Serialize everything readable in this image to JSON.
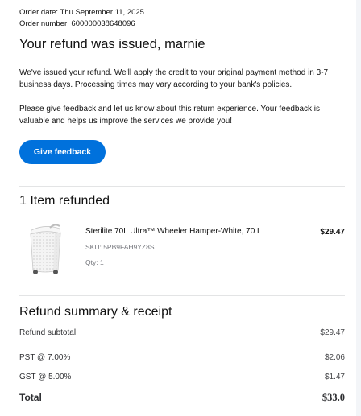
{
  "order": {
    "date_text": "Order date: Thu September 11, 2025",
    "number_text": "Order number: 600000038648096"
  },
  "header": {
    "title": "Your refund was issued, marnie"
  },
  "messages": {
    "refund_info": "We've issued your refund. We'll apply the credit to your original payment method in 3-7 business days. Processing times may vary according to your bank's policies.",
    "feedback_info": "Please give feedback and let us know about this return experience. Your feedback is valuable and helps us improve the services we provide you!"
  },
  "feedback_button": {
    "label": "Give feedback",
    "color": "#0071dc"
  },
  "items_section": {
    "title": "1 Item refunded",
    "items": [
      {
        "name": "Sterilite 70L Ultra™ Wheeler Hamper-White, 70 L",
        "sku": "SKU: 5PB9FAH9YZ8S",
        "qty": "Qty: 1",
        "price": "$29.47",
        "image_icon": "laundry-hamper-image"
      }
    ]
  },
  "summary": {
    "title": "Refund summary & receipt",
    "rows": [
      {
        "label": "Refund subtotal",
        "value": "$29.47"
      },
      {
        "label": "PST @ 7.00%",
        "value": "$2.06"
      },
      {
        "label": "GST @ 5.00%",
        "value": "$1.47"
      }
    ],
    "total": {
      "label": "Total",
      "value": "$33.0"
    }
  }
}
